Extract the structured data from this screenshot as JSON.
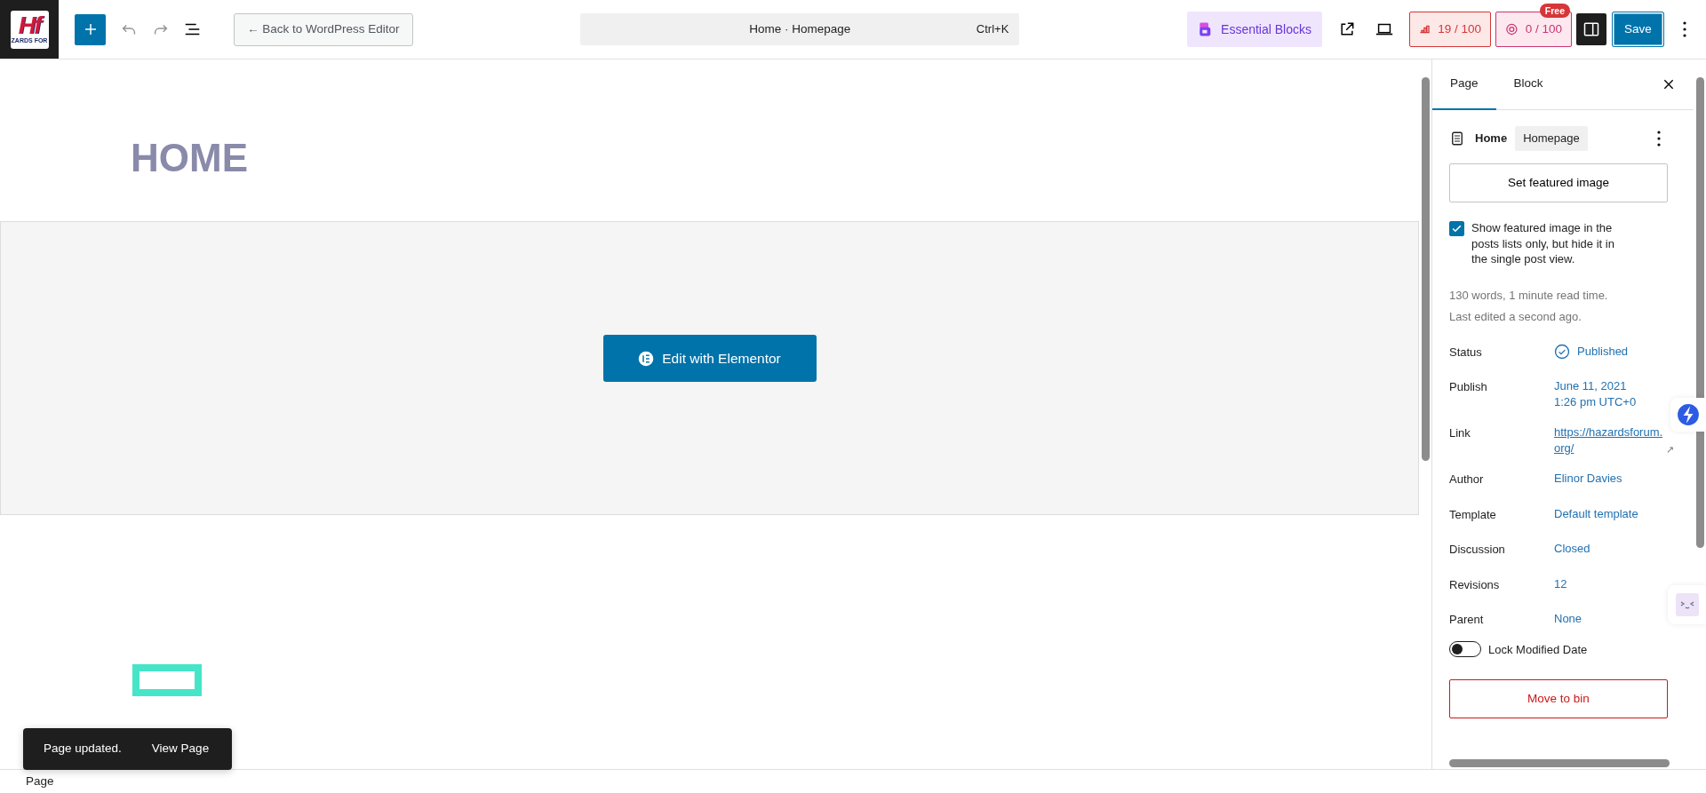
{
  "header": {
    "logo": {
      "mark": "Hf",
      "caption": "ZARDS FOR"
    },
    "back_button": "← Back to WordPress Editor",
    "command": {
      "title": "Home · Homepage",
      "shortcut": "Ctrl+K"
    },
    "essential_blocks": "Essential Blocks",
    "seo_score": "19 / 100",
    "ai_score": {
      "text": "0 / 100",
      "badge": "Free"
    },
    "sidebar_toggle": {
      "on": true
    },
    "save": "Save"
  },
  "canvas": {
    "title": "HOME",
    "elementor_button": "Edit with Elementor"
  },
  "sidebar": {
    "tabs": [
      {
        "label": "Page",
        "selected": true
      },
      {
        "label": "Block",
        "selected": false
      }
    ],
    "page_title": "Home",
    "template_badge": "Homepage",
    "featured_button": "Set featured image",
    "featured_option": {
      "label": "Show featured image in the posts lists only, but hide it in the single post view.",
      "checked": true
    },
    "stats": [
      "130 words, 1 minute read time.",
      "Last edited a second ago."
    ],
    "fields": [
      {
        "label": "Status",
        "kind": "status",
        "lines": [
          "Published"
        ]
      },
      {
        "label": "Publish",
        "kind": "text",
        "lines": [
          "June 11, 2021",
          "1:26 pm UTC+0"
        ]
      },
      {
        "label": "Link",
        "kind": "link",
        "lines": [
          "https://hazardsforum.",
          "org/"
        ],
        "mark": "↗"
      },
      {
        "label": "Author",
        "kind": "text",
        "lines": [
          "Elinor Davies"
        ]
      },
      {
        "label": "Template",
        "kind": "text",
        "lines": [
          "Default template"
        ]
      },
      {
        "label": "Discussion",
        "kind": "text",
        "lines": [
          "Closed"
        ]
      },
      {
        "label": "Revisions",
        "kind": "text",
        "lines": [
          "12"
        ]
      },
      {
        "label": "Parent",
        "kind": "text",
        "lines": [
          "None"
        ]
      }
    ],
    "lock_date": {
      "label": "Lock Modified Date",
      "on": false
    },
    "bin_button": "Move to bin"
  },
  "snackbar": {
    "message": "Page updated.",
    "action": "View Page"
  },
  "footer": {
    "breadcrumb": "Page"
  }
}
